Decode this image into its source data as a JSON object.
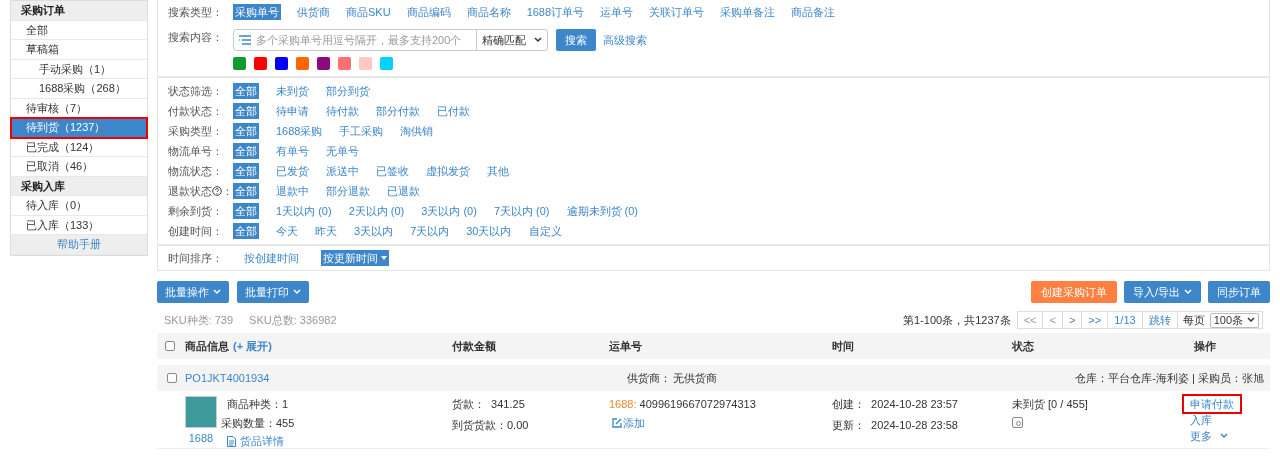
{
  "sidebar": {
    "items": [
      {
        "kind": "header",
        "label": "采购订单"
      },
      {
        "kind": "item",
        "label": "全部",
        "selected": false,
        "highlighted": false
      },
      {
        "kind": "item",
        "label": "草稿箱",
        "selected": false,
        "highlighted": false,
        "children": [
          {
            "label": "手动采购（1）",
            "selected": false,
            "highlighted": false
          },
          {
            "label": "1688采购（268）",
            "selected": false,
            "highlighted": false
          }
        ]
      },
      {
        "kind": "item",
        "label": "待审核（7）",
        "selected": false,
        "highlighted": false
      },
      {
        "kind": "item",
        "label": "待到货（1237）",
        "selected": true,
        "highlighted": true
      },
      {
        "kind": "item",
        "label": "已完成（124）",
        "selected": false,
        "highlighted": false
      },
      {
        "kind": "item",
        "label": "已取消（46）",
        "selected": false,
        "highlighted": false
      },
      {
        "kind": "header",
        "label": "采购入库"
      },
      {
        "kind": "item",
        "label": "待入库（0）",
        "selected": false,
        "highlighted": false
      },
      {
        "kind": "item",
        "label": "已入库（133）",
        "selected": false,
        "highlighted": false
      },
      {
        "kind": "footer",
        "label": "帮助手册"
      }
    ]
  },
  "search": {
    "type_label": "搜索类型：",
    "types": [
      {
        "label": "采购单号",
        "selected": true
      },
      {
        "label": "供货商",
        "selected": false
      },
      {
        "label": "商品SKU",
        "selected": false
      },
      {
        "label": "商品编码",
        "selected": false
      },
      {
        "label": "商品名称",
        "selected": false
      },
      {
        "label": "1688订单号",
        "selected": false
      },
      {
        "label": "运单号",
        "selected": false
      },
      {
        "label": "关联订单号",
        "selected": false
      },
      {
        "label": "采购单备注",
        "selected": false
      },
      {
        "label": "商品备注",
        "selected": false
      }
    ],
    "content_label": "搜索内容：",
    "placeholder": "多个采购单号用逗号隔开，最多支持200个",
    "match": "精确匹配",
    "search_button": "搜索",
    "advanced": "高级搜索",
    "colors": [
      {
        "color": "#119b2c"
      },
      {
        "color": "#ff0000"
      },
      {
        "color": "#0000ff"
      },
      {
        "color": "#ff6600"
      },
      {
        "color": "#8b0a80"
      },
      {
        "color": "#ff7070"
      },
      {
        "color": "#ffc8c0"
      },
      {
        "color": "#00d2ff"
      }
    ]
  },
  "filters": [
    {
      "label": "状态筛选：",
      "help": false,
      "options": [
        {
          "label": "全部",
          "selected": true
        },
        {
          "label": "未到货",
          "selected": false
        },
        {
          "label": "部分到货",
          "selected": false
        }
      ]
    },
    {
      "label": "付款状态：",
      "help": false,
      "options": [
        {
          "label": "全部",
          "selected": true
        },
        {
          "label": "待申请",
          "selected": false
        },
        {
          "label": "待付款",
          "selected": false
        },
        {
          "label": "部分付款",
          "selected": false
        },
        {
          "label": "已付款",
          "selected": false
        }
      ]
    },
    {
      "label": "采购类型：",
      "help": false,
      "options": [
        {
          "label": "全部",
          "selected": true
        },
        {
          "label": "1688采购",
          "selected": false
        },
        {
          "label": "手工采购",
          "selected": false
        },
        {
          "label": "淘供销",
          "selected": false
        }
      ]
    },
    {
      "label": "物流单号：",
      "help": false,
      "options": [
        {
          "label": "全部",
          "selected": true
        },
        {
          "label": "有单号",
          "selected": false
        },
        {
          "label": "无单号",
          "selected": false
        }
      ]
    },
    {
      "label": "物流状态：",
      "help": false,
      "options": [
        {
          "label": "全部",
          "selected": true
        },
        {
          "label": "已发货",
          "selected": false
        },
        {
          "label": "派送中",
          "selected": false
        },
        {
          "label": "已签收",
          "selected": false
        },
        {
          "label": "虚拟发货",
          "selected": false
        },
        {
          "label": "其他",
          "selected": false
        }
      ]
    },
    {
      "label": "退款状态",
      "help": true,
      "suffix": "：",
      "options": [
        {
          "label": "全部",
          "selected": true
        },
        {
          "label": "退款中",
          "selected": false
        },
        {
          "label": "部分退款",
          "selected": false
        },
        {
          "label": "已退款",
          "selected": false
        }
      ]
    },
    {
      "label": "剩余到货：",
      "help": false,
      "options": [
        {
          "label": "全部",
          "selected": true
        },
        {
          "label": "1天以内 (0)",
          "selected": false
        },
        {
          "label": "2天以内 (0)",
          "selected": false
        },
        {
          "label": "3天以内 (0)",
          "selected": false
        },
        {
          "label": "7天以内 (0)",
          "selected": false
        },
        {
          "label": "逾期未到货 (0)",
          "selected": false
        }
      ]
    },
    {
      "label": "创建时间：",
      "help": false,
      "options": [
        {
          "label": "全部",
          "selected": true
        },
        {
          "label": "今天",
          "selected": false
        },
        {
          "label": "昨天",
          "selected": false
        },
        {
          "label": "3天以内",
          "selected": false
        },
        {
          "label": "7天以内",
          "selected": false
        },
        {
          "label": "30天以内",
          "selected": false
        },
        {
          "label": "自定义",
          "selected": false
        }
      ]
    }
  ],
  "sort": {
    "label": "时间排序：",
    "options": [
      {
        "label": "按创建时间",
        "selected": false
      },
      {
        "label": "按更新时间",
        "selected": true
      }
    ]
  },
  "toolbar": {
    "left": [
      "批量操作",
      "批量打印"
    ],
    "create": "创建采购订单",
    "import_export": "导入/导出",
    "sync": "同步订单"
  },
  "stats": [
    "SKU种类: 739",
    "SKU总数: 336982"
  ],
  "pagination": {
    "summary": "第1-100条，共1237条",
    "first": "<<",
    "prev": "<",
    "next": ">",
    "last": ">>",
    "page": "1/13",
    "jump": "跳转",
    "per_page_label": "每页",
    "per_page": "100条"
  },
  "table": {
    "header_checked": false,
    "columns": [
      "商品信息",
      "付款金额",
      "运单号",
      "时间",
      "状态",
      "操作"
    ],
    "expand": "(+ 展开)",
    "orders": [
      {
        "checked": false,
        "order_no": "PO1JKT4001934",
        "supplier_label": "供货商：",
        "supplier": "无供货商",
        "meta": "仓库：平台仓库-海利姿 | 采购员：张旭",
        "source": "1688",
        "sku_types": "商品种类：1",
        "quantity": "采购数量：455",
        "details": "货品详情",
        "payment": "货款：  341.25",
        "arrival_payment": "到货货款：0.00",
        "carrier": "1688:",
        "tracking_no": "4099619667072974313",
        "add": "添加",
        "created": "创建：  2024-10-28 23:57",
        "updated": "更新：  2024-10-28 23:58",
        "status": "未到货 [0 / 455]",
        "actions": [
          {
            "kind": "link",
            "label": "申请付款",
            "highlighted": true
          },
          {
            "kind": "link",
            "label": "入库",
            "highlighted": false
          },
          {
            "kind": "menu",
            "label": "更多",
            "highlighted": false
          }
        ]
      }
    ]
  }
}
